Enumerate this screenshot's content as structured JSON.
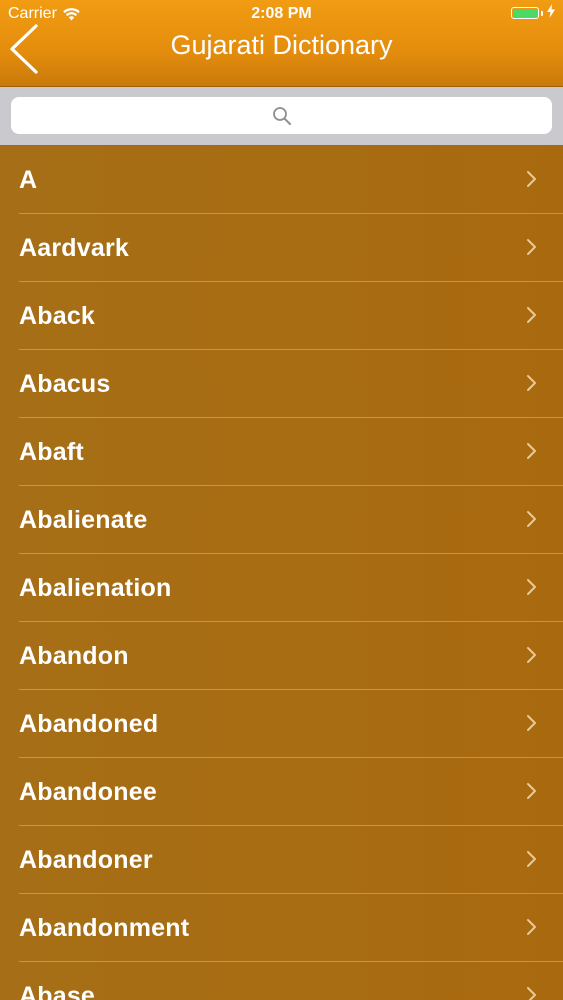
{
  "status_bar": {
    "carrier": "Carrier",
    "time": "2:08 PM",
    "battery_level": 1.0,
    "battery_color": "#4cd964"
  },
  "nav": {
    "title": "Gujarati Dictionary",
    "back_icon": "chevron-left-icon"
  },
  "search": {
    "placeholder": "",
    "value": "",
    "icon": "search-icon"
  },
  "colors": {
    "nav_orange": "#e48d0d",
    "list_brown": "#a86c12",
    "text": "#ffffff"
  },
  "words": [
    "A",
    "Aardvark",
    "Aback",
    "Abacus",
    "Abaft",
    "Abalienate",
    "Abalienation",
    "Abandon",
    "Abandoned",
    "Abandonee",
    "Abandoner",
    "Abandonment",
    "Abase"
  ]
}
